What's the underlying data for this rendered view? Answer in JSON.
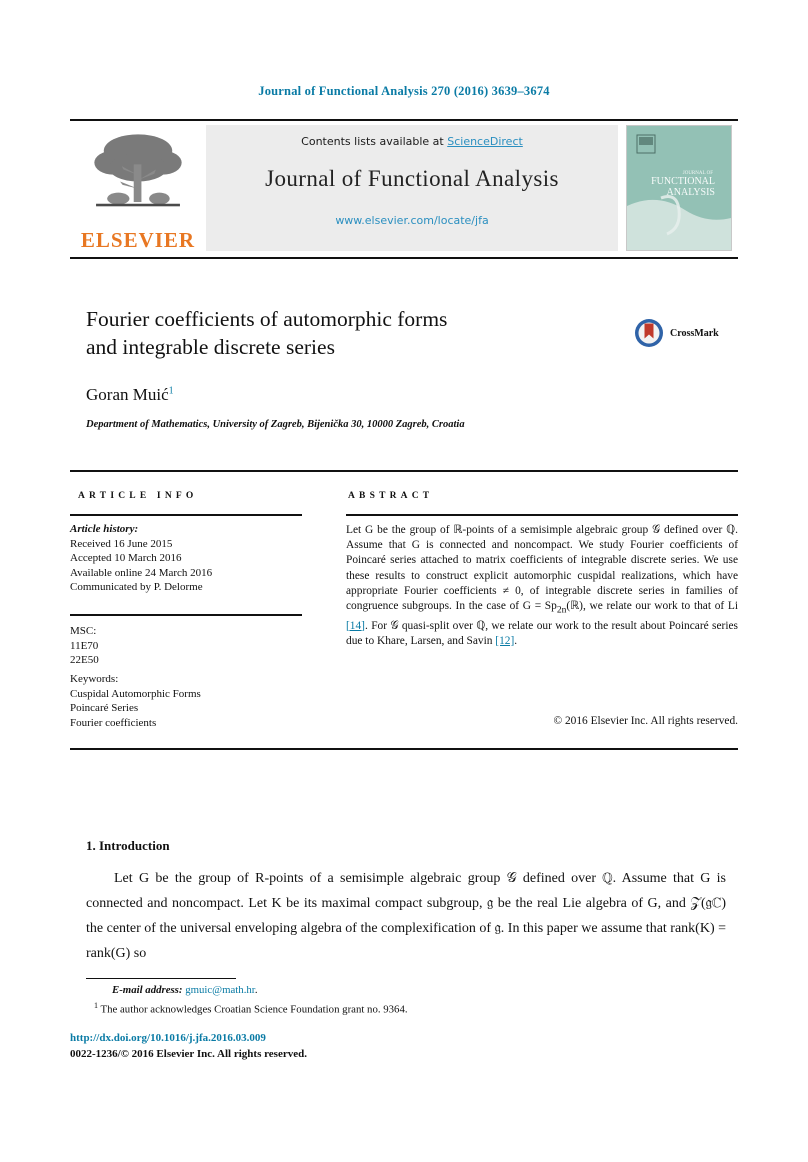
{
  "running_head": "Journal of Functional Analysis 270 (2016) 3639–3674",
  "masthead": {
    "contents_prefix": "Contents lists available at ",
    "sciencedirect": "ScienceDirect",
    "journal_title": "Journal of Functional Analysis",
    "url": "www.elsevier.com/locate/jfa",
    "publisher_logo_text": "ELSEVIER",
    "cover_line1": "JOURNAL OF",
    "cover_line2": "FUNCTIONAL",
    "cover_line3": "ANALYSIS"
  },
  "article": {
    "title_line1": "Fourier coefficients of automorphic forms",
    "title_line2": "and integrable discrete series",
    "crossmark_label": "CrossMark",
    "author": "Goran Muić",
    "author_footnote_marker": "1",
    "affiliation": "Department of Mathematics, University of Zagreb, Bijenička 30, 10000 Zagreb, Croatia"
  },
  "headers": {
    "article_info": "ARTICLE INFO",
    "abstract": "ABSTRACT"
  },
  "info": {
    "history_label": "Article history:",
    "received": "Received 16 June 2015",
    "accepted": "Accepted 10 March 2016",
    "available_online": "Available online 24 March 2016",
    "communicated_by": "Communicated by P. Delorme",
    "msc_label": "MSC:",
    "msc_codes": [
      "11E70",
      "22E50"
    ],
    "keywords_label": "Keywords:",
    "keywords": [
      "Cuspidal Automorphic Forms",
      "Poincaré Series",
      "Fourier coefficients"
    ]
  },
  "abstract_text": {
    "part1": "Let G be the group of ℝ-points of a semisimple algebraic group 𝒢 defined over ℚ. Assume that G is connected and noncompact. We study Fourier coefficients of Poincaré series attached to matrix coefficients of integrable discrete series. We use these results to construct explicit automorphic cuspidal realizations, which have appropriate Fourier coefficients ≠ 0, of integrable discrete series in families of congruence subgroups. In the case of G = Sp",
    "sub1": "2n",
    "part2": "(ℝ), we relate our work to that of Li ",
    "cite1": "[14]",
    "part3": ". For 𝒢 quasi-split over ℚ, we relate our work to the result about Poincaré series due to Khare, Larsen, and Savin ",
    "cite2": "[12]",
    "part4": ".",
    "copyright": "© 2016 Elsevier Inc. All rights reserved."
  },
  "body": {
    "section_number_title": "1. Introduction",
    "paragraph": "Let G be the group of R-points of a semisimple algebraic group 𝒢 defined over ℚ. Assume that G is connected and noncompact. Let K be its maximal compact subgroup, 𝔤 be the real Lie algebra of G, and 𝒵(𝔤ℂ) the center of the universal enveloping algebra of the complexification of 𝔤. In this paper we assume that rank(K) = rank(G) so"
  },
  "footnotes": {
    "email_label": "E-mail address:",
    "email": "gmuic@math.hr",
    "email_period": ".",
    "note_marker": "1",
    "note_text": "The author acknowledges Croatian Science Foundation grant no. 9364."
  },
  "footer": {
    "doi": "http://dx.doi.org/10.1016/j.jfa.2016.03.009",
    "issn_line": "0022-1236/© 2016 Elsevier Inc. All rights reserved."
  },
  "colors": {
    "link_blue": "#0a7ba5",
    "elsevier_orange": "#e87722",
    "cover_teal": "#8fc0b4",
    "crossmark_blue": "#2f63a8",
    "crossmark_red": "#c0392b"
  }
}
